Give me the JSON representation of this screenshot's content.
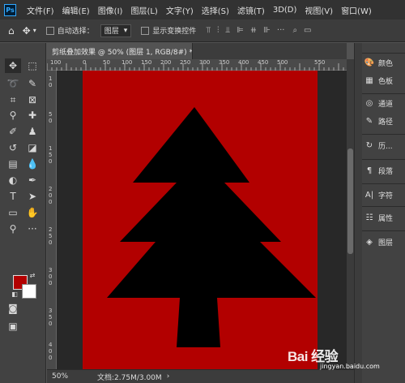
{
  "app": {
    "logo_text": "Ps",
    "menu": [
      "文件(F)",
      "编辑(E)",
      "图像(I)",
      "图层(L)",
      "文字(Y)",
      "选择(S)",
      "滤镜(T)",
      "3D(D)",
      "视图(V)",
      "窗口(W)"
    ]
  },
  "options_bar": {
    "auto_select_label": "自动选择：",
    "auto_select_target": "图层",
    "show_transform_label": "显示变换控件"
  },
  "document": {
    "tab_title": "剪纸叠加效果 @ 50% (图层 1, RGB/8#) *",
    "close_icon": "close-icon"
  },
  "rulers": {
    "top_ticks": [
      "100",
      "50",
      "0",
      "50",
      "100",
      "150",
      "200",
      "250",
      "300",
      "350",
      "400",
      "450",
      "500",
      "550"
    ],
    "left_ticks": [
      "1",
      "0",
      "5",
      "0",
      "1",
      "5",
      "0",
      "2",
      "0",
      "0",
      "2",
      "5",
      "0",
      "3",
      "0",
      "0",
      "3",
      "5",
      "0",
      "4",
      "0",
      "0",
      "4",
      "5",
      "0",
      "5",
      "0",
      "0",
      "5",
      "5",
      "0"
    ]
  },
  "colors": {
    "foreground": "#b20000",
    "background": "#ffffff",
    "canvas": "#b20000",
    "shape": "#000000"
  },
  "status": {
    "zoom": "50%",
    "doc_size": "文档:2.75M/3.00M"
  },
  "right_panels": [
    {
      "icon": "palette-icon",
      "label": "颜色"
    },
    {
      "icon": "swatches-icon",
      "label": "色板"
    },
    {
      "icon": "channels-icon",
      "label": "通道"
    },
    {
      "icon": "paths-icon",
      "label": "路径"
    },
    {
      "icon": "history-icon",
      "label": "历..."
    },
    {
      "icon": "paragraph-icon",
      "label": "段落"
    },
    {
      "icon": "character-icon",
      "label": "字符"
    },
    {
      "icon": "properties-icon",
      "label": "属性"
    },
    {
      "icon": "layers-icon",
      "label": "图层"
    }
  ],
  "watermark": {
    "logo": "Bai 经验",
    "url": "jingyan.baidu.com"
  }
}
